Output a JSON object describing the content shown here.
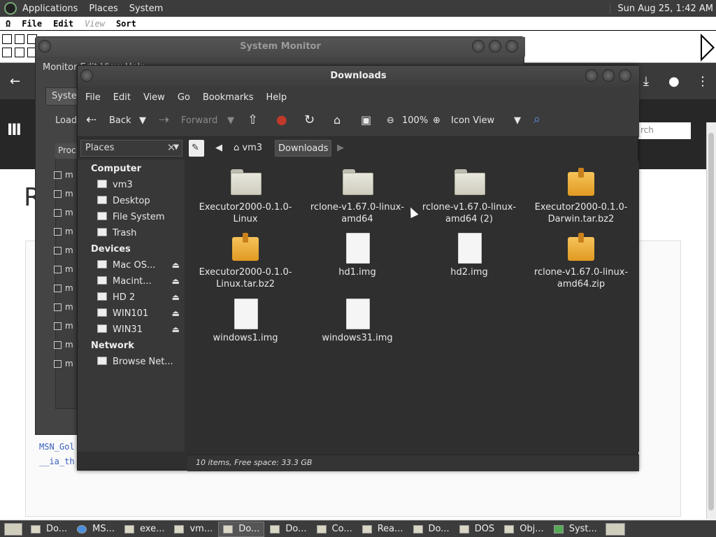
{
  "top_panel": {
    "menus": [
      "Applications",
      "Places",
      "System"
    ],
    "clock": "Sun Aug 25,  1:42 AM"
  },
  "mac_bar": {
    "apple": "Ω",
    "menus": [
      "File",
      "Edit",
      "View",
      "Sort"
    ]
  },
  "browser": {
    "search_placeholder": "rch",
    "big_letter": "R",
    "code_lines": [
      "MSN_Gol",
      "__ia_th"
    ]
  },
  "system_monitor": {
    "title": "System Monitor",
    "menu": "Monitor  Edit  View  Help",
    "tab": "System",
    "load_label": "Load",
    "proc_header": "Proc",
    "rows": [
      "m",
      "m",
      "m",
      "m",
      "m",
      "m",
      "m",
      "m",
      "m",
      "m",
      "m"
    ]
  },
  "downloads": {
    "title": "Downloads",
    "menu": [
      "File",
      "Edit",
      "View",
      "Go",
      "Bookmarks",
      "Help"
    ],
    "toolbar": {
      "back": "Back",
      "forward": "Forward",
      "zoom": "100%",
      "view_mode": "Icon View"
    },
    "sidebar_selector": "Places",
    "sidebar": {
      "computer_header": "Computer",
      "computer_items": [
        "vm3",
        "Desktop",
        "File System",
        "Trash"
      ],
      "devices_header": "Devices",
      "device_items": [
        "Mac OS...",
        "Macint...",
        "HD 2",
        "WIN101",
        "WIN31"
      ],
      "network_header": "Network",
      "network_items": [
        "Browse Net..."
      ]
    },
    "path": [
      "vm3",
      "Downloads"
    ],
    "files": [
      {
        "name": "Executor2000-0.1.0-Linux",
        "kind": "folder"
      },
      {
        "name": "rclone-v1.67.0-linux-amd64",
        "kind": "folder"
      },
      {
        "name": "rclone-v1.67.0-linux-amd64 (2)",
        "kind": "folder"
      },
      {
        "name": "Executor2000-0.1.0-Darwin.tar.bz2",
        "kind": "archive"
      },
      {
        "name": "Executor2000-0.1.0-Linux.tar.bz2",
        "kind": "archive"
      },
      {
        "name": "hd1.img",
        "kind": "doc"
      },
      {
        "name": "hd2.img",
        "kind": "doc"
      },
      {
        "name": "rclone-v1.67.0-linux-amd64.zip",
        "kind": "archive"
      },
      {
        "name": "windows1.img",
        "kind": "doc"
      },
      {
        "name": "windows31.img",
        "kind": "doc"
      }
    ],
    "status": "10 items, Free space: 33.3 GB"
  },
  "taskbar": {
    "tasks": [
      "Do...",
      "MS...",
      "exe...",
      "vm...",
      "Do...",
      "Do...",
      "Co...",
      "Rea...",
      "Do...",
      "DOS",
      "Obj...",
      "Syst..."
    ]
  },
  "colors": {
    "panel": "#3c3c3c",
    "window_bg": "#2f2f2f",
    "archive": "#f0b040",
    "folder": "#dcdacc"
  }
}
